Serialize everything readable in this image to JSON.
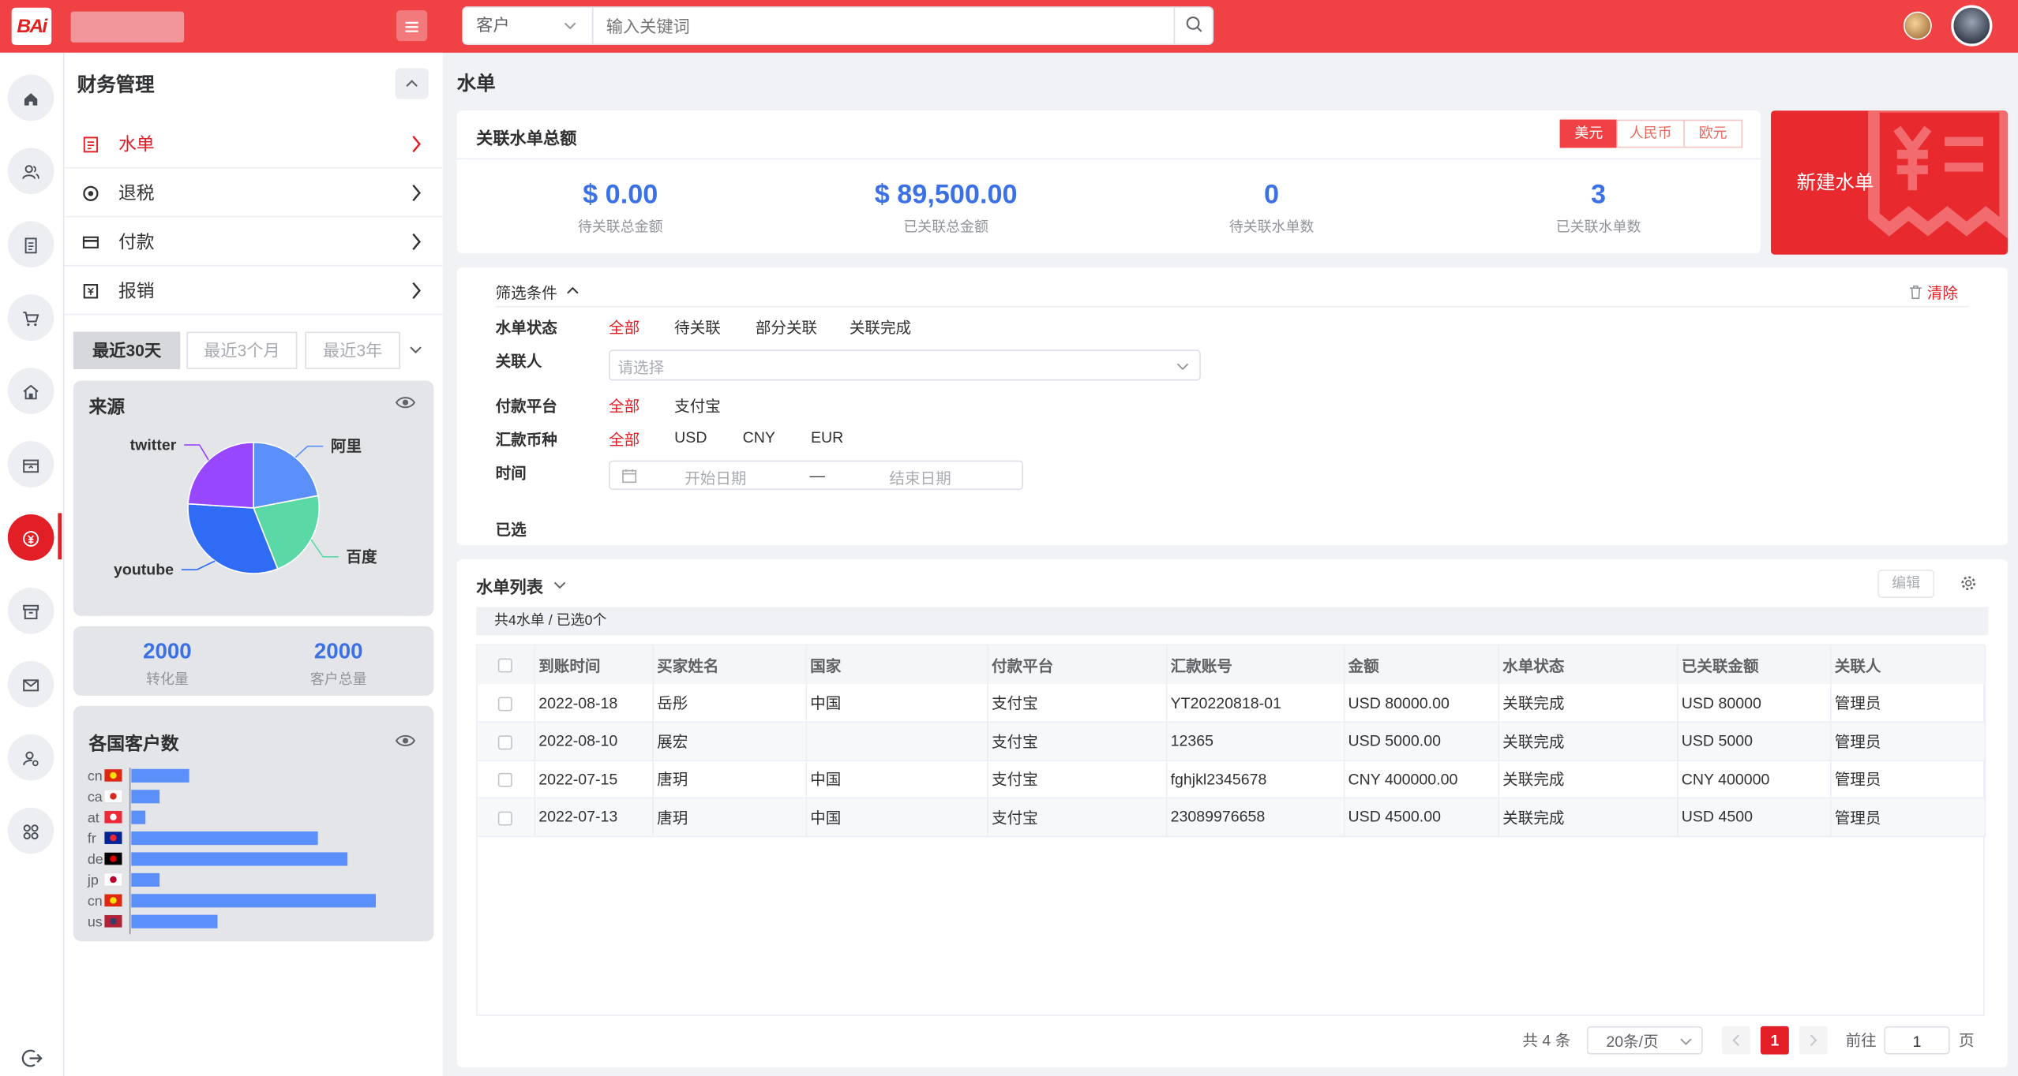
{
  "topbar": {
    "logo_text": "BAi",
    "menu_icon": "hamburger-icon",
    "search": {
      "select_value": "客户",
      "placeholder": "输入关键词",
      "icon": "search-icon"
    },
    "accent": "#f04245"
  },
  "rail": {
    "items": [
      {
        "name": "home",
        "icon": "home-icon"
      },
      {
        "name": "customers",
        "icon": "users-icon"
      },
      {
        "name": "documents",
        "icon": "document-icon"
      },
      {
        "name": "cart",
        "icon": "cart-icon"
      },
      {
        "name": "store",
        "icon": "store-icon"
      },
      {
        "name": "archive-box",
        "icon": "box-icon"
      },
      {
        "name": "finance",
        "icon": "money-icon",
        "active": true
      },
      {
        "name": "inventory",
        "icon": "archive-icon"
      },
      {
        "name": "mail",
        "icon": "mail-icon"
      },
      {
        "name": "user-settings",
        "icon": "user-gear-icon"
      },
      {
        "name": "apps",
        "icon": "apps-icon"
      }
    ],
    "logout_icon": "logout-icon"
  },
  "menu": {
    "title": "财务管理",
    "items": [
      {
        "label": "水单",
        "icon": "receipt-icon",
        "active": true
      },
      {
        "label": "退税",
        "icon": "refund-icon"
      },
      {
        "label": "付款",
        "icon": "card-icon"
      },
      {
        "label": "报销",
        "icon": "reimburse-icon"
      }
    ]
  },
  "range_tabs": [
    "最近30天",
    "最近3个月",
    "最近3年"
  ],
  "source_card": {
    "title": "来源",
    "chart_data": {
      "type": "pie",
      "labels": [
        "阿里",
        "百度",
        "youtube",
        "twitter"
      ],
      "values": [
        22,
        22,
        32,
        24
      ],
      "colors": [
        "#5b8ff9",
        "#5ad8a6",
        "#2f6bf5",
        "#9747ff"
      ]
    }
  },
  "stats_card": {
    "items": [
      {
        "value": "2000",
        "label": "转化量"
      },
      {
        "value": "2000",
        "label": "客户总量"
      }
    ]
  },
  "country_card": {
    "title": "各国客户数",
    "chart_data": {
      "type": "bar",
      "categories": [
        "cn",
        "ca",
        "at",
        "fr",
        "de",
        "jp",
        "cn",
        "us"
      ],
      "values": [
        45,
        22,
        11,
        145,
        168,
        22,
        190,
        67
      ],
      "color": "#5b8ff9"
    }
  },
  "page_title": "水单",
  "summary": {
    "title": "关联水单总额",
    "currencies": [
      "美元",
      "人民币",
      "欧元"
    ],
    "items": [
      {
        "value": "$ 0.00",
        "label": "待关联总金额"
      },
      {
        "value": "$ 89,500.00",
        "label": "已关联总金额"
      },
      {
        "value": "0",
        "label": "待关联水单数"
      },
      {
        "value": "3",
        "label": "已关联水单数"
      }
    ],
    "new_button": "新建水单"
  },
  "filters": {
    "title": "筛选条件",
    "clear": "清除",
    "status_label": "水单状态",
    "status_options": [
      "全部",
      "待关联",
      "部分关联",
      "关联完成"
    ],
    "associate_label": "关联人",
    "associate_placeholder": "请选择",
    "platform_label": "付款平台",
    "platform_options": [
      "全部",
      "支付宝"
    ],
    "currency_label": "汇款币种",
    "currency_options": [
      "全部",
      "USD",
      "CNY",
      "EUR"
    ],
    "time_label": "时间",
    "start_placeholder": "开始日期",
    "separator": "—",
    "end_placeholder": "结束日期",
    "selected_label": "已选"
  },
  "list": {
    "title": "水单列表",
    "edit": "编辑",
    "count_text": "共4水单 / 已选0个",
    "columns": [
      "到账时间",
      "买家姓名",
      "国家",
      "付款平台",
      "汇款账号",
      "金额",
      "水单状态",
      "已关联金额",
      "关联人"
    ],
    "rows": [
      [
        "2022-08-18",
        "岳彤",
        "中国",
        "支付宝",
        "YT20220818-01",
        "USD 80000.00",
        "关联完成",
        "USD 80000",
        "管理员"
      ],
      [
        "2022-08-10",
        "展宏",
        "",
        "支付宝",
        "12365",
        "USD 5000.00",
        "关联完成",
        "USD 5000",
        "管理员"
      ],
      [
        "2022-07-15",
        "唐玥",
        "中国",
        "支付宝",
        "fghjkl2345678",
        "CNY 400000.00",
        "关联完成",
        "CNY 400000",
        "管理员"
      ],
      [
        "2022-07-13",
        "唐玥",
        "中国",
        "支付宝",
        "23089976658",
        "USD 4500.00",
        "关联完成",
        "USD 4500",
        "管理员"
      ]
    ]
  },
  "pagination": {
    "total": "共 4 条",
    "page_size": "20条/页",
    "current": "1",
    "goto_label": "前往",
    "goto_value": "1",
    "page_suffix": "页"
  }
}
